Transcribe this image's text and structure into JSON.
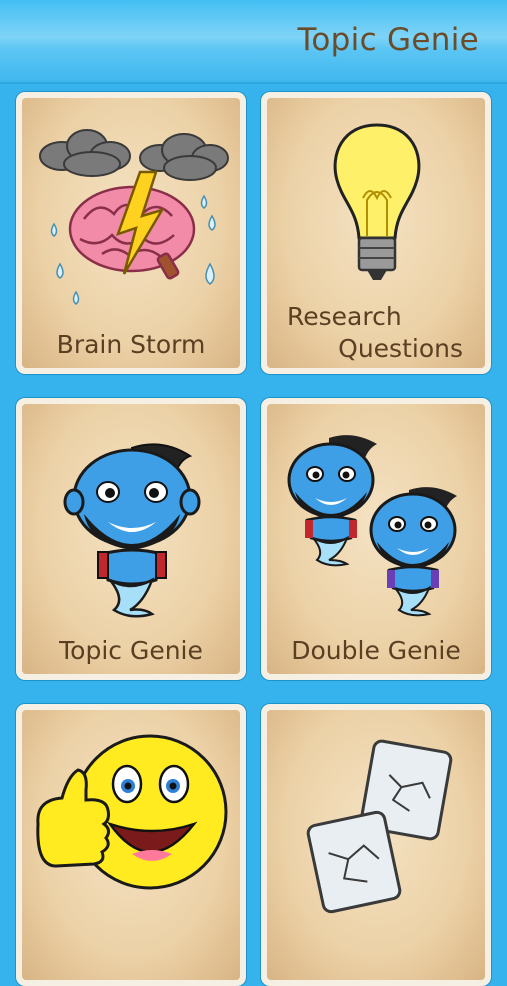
{
  "header": {
    "title": "Topic Genie"
  },
  "cards": [
    {
      "label": "Brain Storm",
      "icon": "brain-storm-icon"
    },
    {
      "label_line1": "Research",
      "label_line2": "Questions",
      "icon": "lightbulb-icon"
    },
    {
      "label": "Topic Genie",
      "icon": "genie-icon"
    },
    {
      "label": "Double Genie",
      "icon": "double-genie-icon"
    },
    {
      "label": "",
      "icon": "thumbs-up-smiley-icon"
    },
    {
      "label": "",
      "icon": "broken-cards-icon"
    }
  ],
  "colors": {
    "background": "#36b3ec",
    "title_text": "#6b4c2a",
    "card_parchment": "#ecd1a6",
    "genie_blue": "#3f9fe6"
  }
}
